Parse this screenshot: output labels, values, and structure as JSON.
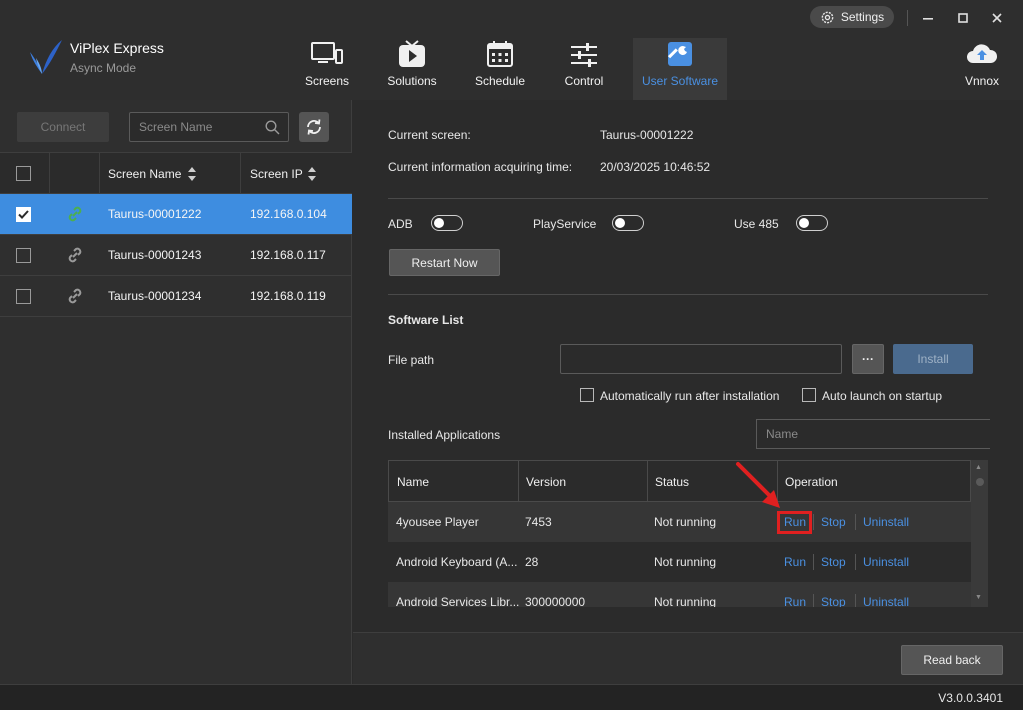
{
  "app": {
    "name": "ViPlex Express",
    "mode": "Async Mode"
  },
  "titlebar": {
    "settings_label": "Settings",
    "minimize": "—",
    "maximize": "☐",
    "close": "✕"
  },
  "nav": {
    "screens": "Screens",
    "solutions": "Solutions",
    "schedule": "Schedule",
    "control": "Control",
    "user_software": "User Software",
    "vnnox": "Vnnox",
    "active": "User Software",
    "accent_color": "#4a90e2"
  },
  "left": {
    "connect_label": "Connect",
    "search_placeholder": "Screen Name",
    "headers": {
      "name": "Screen Name",
      "ip": "Screen IP"
    },
    "rows": [
      {
        "name": "Taurus-00001222",
        "ip": "192.168.0.104",
        "checked": true,
        "connected": true
      },
      {
        "name": "Taurus-00001243",
        "ip": "192.168.0.117",
        "checked": false,
        "connected": false
      },
      {
        "name": "Taurus-00001234",
        "ip": "192.168.0.119",
        "checked": false,
        "connected": false
      }
    ],
    "selected_color": "#3e8de0"
  },
  "info": {
    "current_screen_label": "Current screen:",
    "current_screen_value": "Taurus-00001222",
    "acq_time_label": "Current information acquiring time:",
    "acq_time_value": "20/03/2025 10:46:52"
  },
  "toggles": {
    "adb": "ADB",
    "playservice": "PlayService",
    "use485": "Use 485"
  },
  "restart_label": "Restart Now",
  "software": {
    "title": "Software List",
    "file_path_label": "File path",
    "browse_label": "···",
    "install_label": "Install",
    "auto_run_label": "Automatically run after installation",
    "auto_launch_label": "Auto launch on startup",
    "installed_label": "Installed Applications",
    "name_placeholder": "Name"
  },
  "apps": {
    "headers": {
      "name": "Name",
      "version": "Version",
      "status": "Status",
      "operation": "Operation"
    },
    "run": "Run",
    "stop": "Stop",
    "uninstall": "Uninstall",
    "rows": [
      {
        "name": "4yousee Player",
        "version": "7453",
        "status": "Not running"
      },
      {
        "name": "Android Keyboard (A...",
        "version": "28",
        "status": "Not running"
      },
      {
        "name": "Android Services Libr...",
        "version": "300000000",
        "status": "Not running"
      }
    ]
  },
  "readback_label": "Read back",
  "version": "V3.0.0.3401",
  "highlight_color": "#e02020"
}
